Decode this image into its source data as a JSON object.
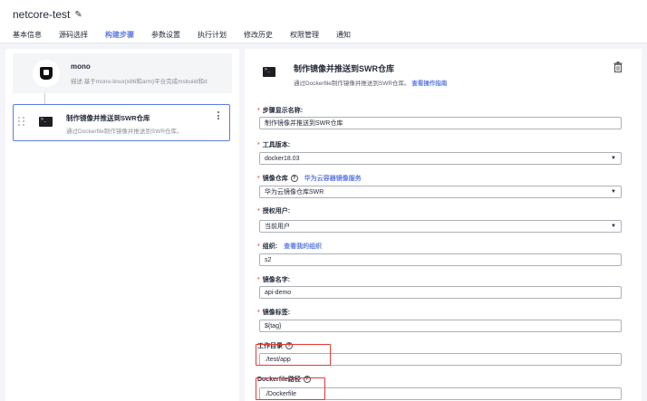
{
  "header": {
    "title": "netcore-test",
    "tabs": [
      {
        "label": "基本信息",
        "active": false
      },
      {
        "label": "源码选择",
        "active": false
      },
      {
        "label": "构建步骤",
        "active": true
      },
      {
        "label": "参数设置",
        "active": false
      },
      {
        "label": "执行计划",
        "active": false
      },
      {
        "label": "修改历史",
        "active": false
      },
      {
        "label": "权限管理",
        "active": false
      },
      {
        "label": "通知",
        "active": false
      }
    ]
  },
  "steps": [
    {
      "name": "mono",
      "desc": "描述:基于mono-linux(x86和arm)平台完成msbuild和d"
    },
    {
      "name": "制作镜像并推送到SWR仓库",
      "desc": "通过Dockerfile制作镜像并推送到SWR仓库。"
    }
  ],
  "detail": {
    "title": "制作镜像并推送到SWR仓库",
    "desc": "通过Dockerfile制作镜像并推送到SWR仓库。",
    "guide_link": "查看操作指南",
    "fields": {
      "display_name": {
        "label": "步骤显示名称:",
        "value": "制作镜像并推送到SWR仓库"
      },
      "tool_version": {
        "label": "工具版本:",
        "value": "docker18.03"
      },
      "registry": {
        "label": "镜像仓库",
        "link": "华为云容器镜像服务",
        "value": "华为云镜像仓库SWR"
      },
      "auth_user": {
        "label": "授权用户:",
        "value": "当前用户"
      },
      "org": {
        "label": "组织:",
        "link": "查看我的组织",
        "value": "s2"
      },
      "image_name": {
        "label": "镜像名字:",
        "value": "api-demo"
      },
      "image_tag": {
        "label": "镜像标签:",
        "value": "${tag}"
      },
      "work_dir": {
        "label": "工作目录",
        "value": "./test/app"
      },
      "dockerfile_path": {
        "label": "Dockerfile路径",
        "value": "./Dockerfile"
      }
    }
  },
  "colors": {
    "accent": "#5e7ce0",
    "required": "#f66f6a",
    "highlight": "#e53935"
  }
}
